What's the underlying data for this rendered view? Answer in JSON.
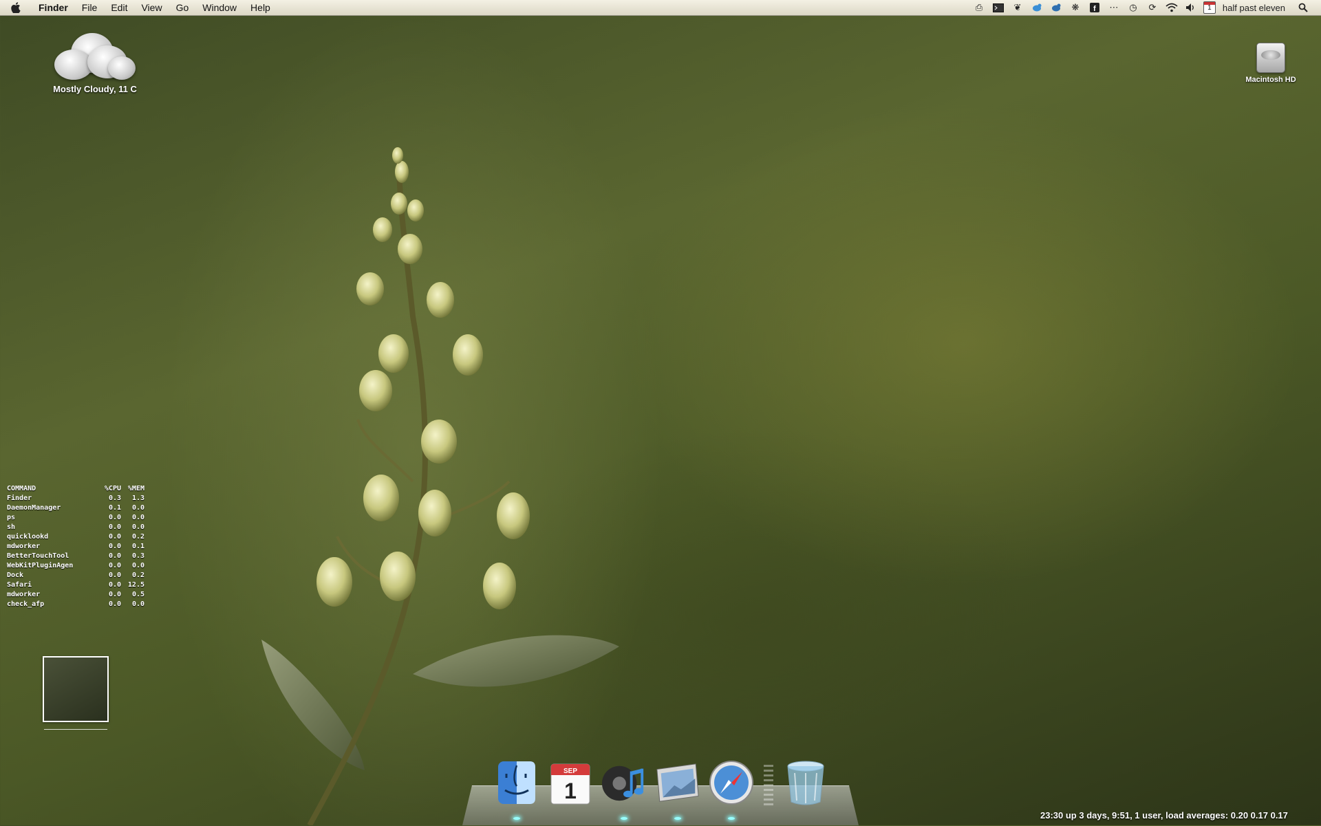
{
  "menubar": {
    "app_name": "Finder",
    "menus": [
      "File",
      "Edit",
      "View",
      "Go",
      "Window",
      "Help"
    ],
    "status_icons": [
      "printer-icon",
      "terminal-icon",
      "butterfly-icon",
      "twitter-bird-icon",
      "twitter-bird-2-icon",
      "growl-paw-icon",
      "facebook-icon",
      "dots-icon",
      "time-machine-icon",
      "sync-icon",
      "wifi-icon",
      "volume-icon"
    ],
    "calendar_day": "1",
    "clock": "half past eleven"
  },
  "weather": {
    "condition": "Mostly Cloudy, 11 C"
  },
  "drive": {
    "label": "Macintosh HD"
  },
  "processes": {
    "headers": [
      "COMMAND",
      "%CPU",
      "%MEM"
    ],
    "rows": [
      [
        "Finder",
        "0.3",
        "1.3"
      ],
      [
        "DaemonManager",
        "0.1",
        "0.0"
      ],
      [
        "ps",
        "0.0",
        "0.0"
      ],
      [
        "sh",
        "0.0",
        "0.0"
      ],
      [
        "quicklookd",
        "0.0",
        "0.2"
      ],
      [
        "mdworker",
        "0.0",
        "0.1"
      ],
      [
        "BetterTouchTool",
        "0.0",
        "0.3"
      ],
      [
        "WebKitPluginAgen",
        "0.0",
        "0.0"
      ],
      [
        "Dock",
        "0.0",
        "0.2"
      ],
      [
        "Safari",
        "0.0",
        "12.5"
      ],
      [
        "mdworker",
        "0.0",
        "0.5"
      ],
      [
        "check_afp",
        "0.0",
        "0.0"
      ]
    ]
  },
  "dock": {
    "calendar_month": "SEP",
    "calendar_day": "1",
    "items": [
      "finder-icon",
      "ical-icon",
      "itunes-icon",
      "mail-icon",
      "safari-icon",
      "trash-icon"
    ]
  },
  "uptime": "23:30  up 3 days,  9:51, 1 user, load averages: 0.20 0.17 0.17"
}
